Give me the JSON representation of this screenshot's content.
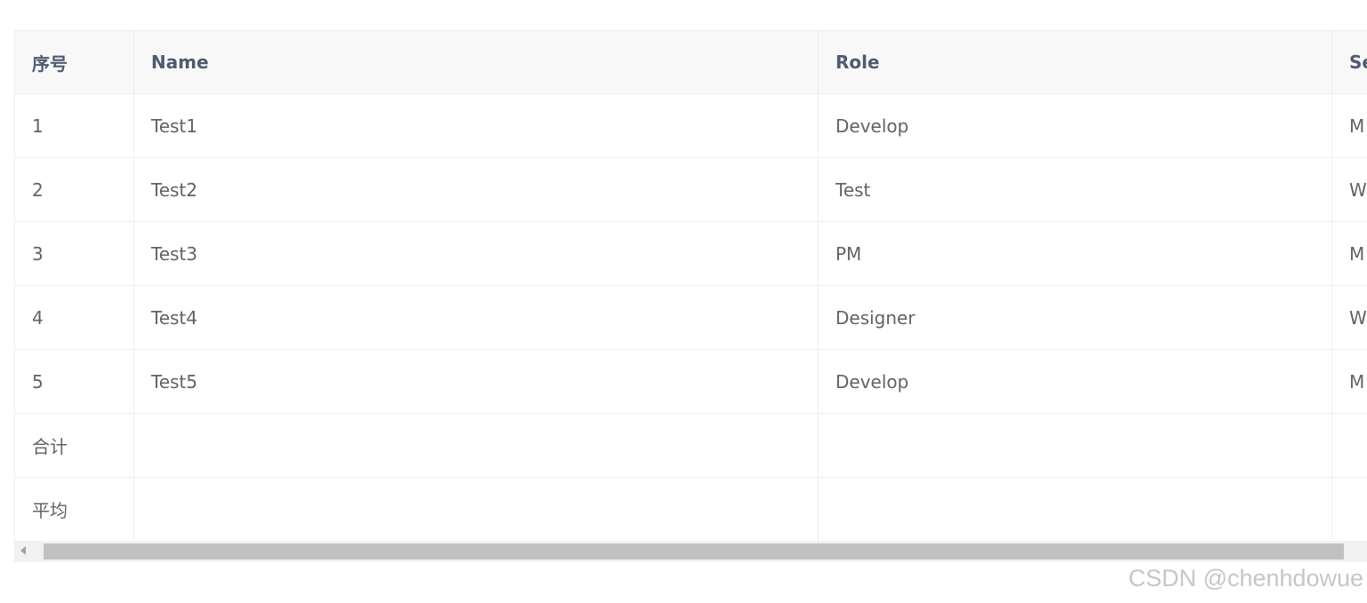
{
  "table": {
    "headers": [
      "序号",
      "Name",
      "Role",
      "Se"
    ],
    "rows": [
      [
        "1",
        "Test1",
        "Develop",
        "M"
      ],
      [
        "2",
        "Test2",
        "Test",
        "W"
      ],
      [
        "3",
        "Test3",
        "PM",
        "M"
      ],
      [
        "4",
        "Test4",
        "Designer",
        "W"
      ],
      [
        "5",
        "Test5",
        "Develop",
        "M"
      ]
    ],
    "summary_rows": [
      [
        "合计",
        "",
        "",
        ""
      ],
      [
        "平均",
        "",
        "",
        ""
      ]
    ]
  },
  "watermark": "CSDN @chenhdowue"
}
